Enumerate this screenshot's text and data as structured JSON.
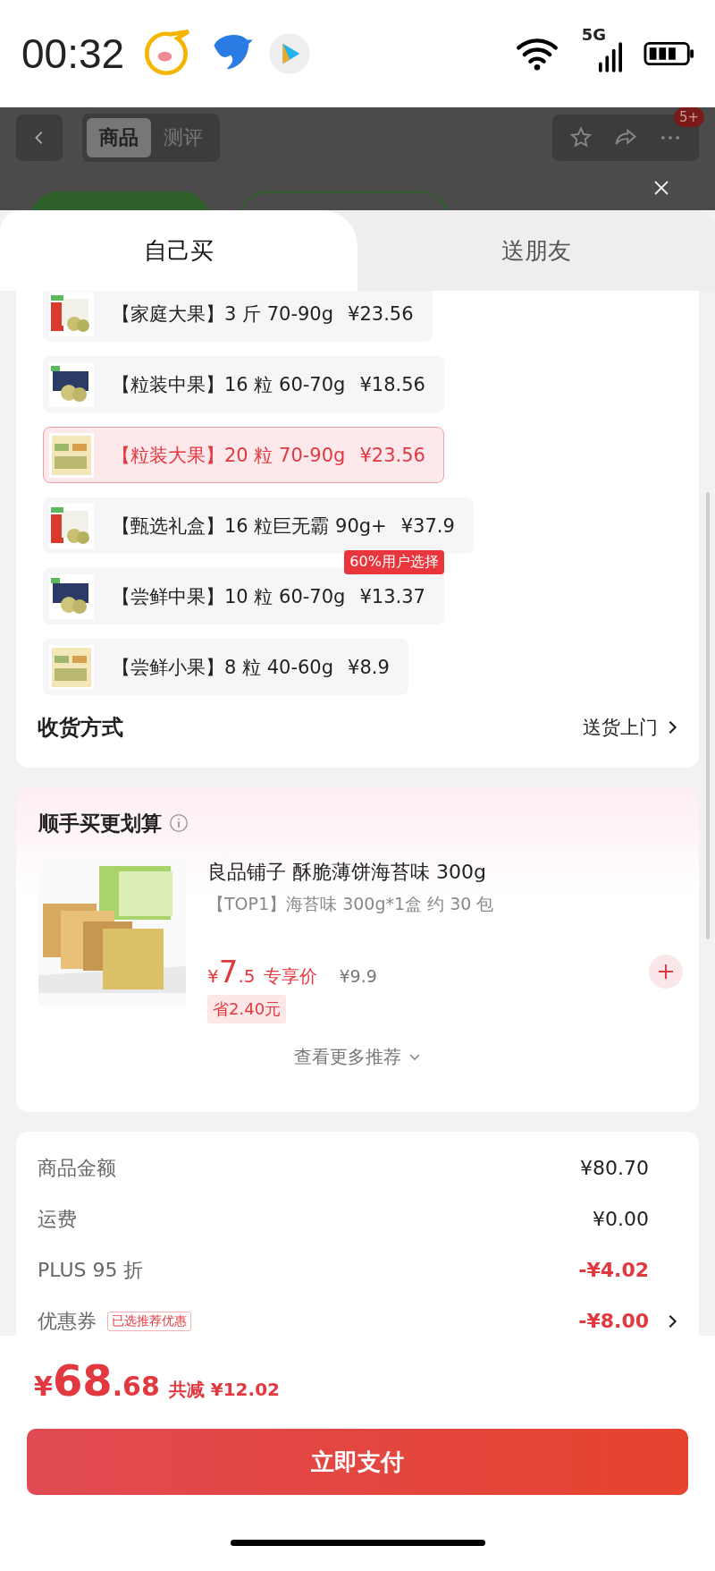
{
  "status_bar": {
    "time": "00:32",
    "network": "5G"
  },
  "nav": {
    "tabs": [
      {
        "label": "商品",
        "selected": true
      },
      {
        "label": "测评",
        "selected": false
      }
    ],
    "badge": "5+"
  },
  "sheet_tabs": [
    {
      "label": "自己买",
      "selected": true
    },
    {
      "label": "送朋友",
      "selected": false
    }
  ],
  "options": [
    {
      "name": "【家庭大果】3 斤 70-90g",
      "price": "¥23.56",
      "selected": false
    },
    {
      "name": "【粒装中果】16 粒 60-70g",
      "price": "¥18.56",
      "selected": false
    },
    {
      "name": "【粒装大果】20 粒 70-90g",
      "price": "¥23.56",
      "selected": true
    },
    {
      "name": "【甄选礼盒】16 粒巨无霸 90g+",
      "price": "¥37.9",
      "selected": false
    },
    {
      "name": "【尝鲜中果】10 粒 60-70g",
      "price": "¥13.37",
      "selected": false,
      "tag": "60%用户选择"
    },
    {
      "name": "【尝鲜小果】8 粒 40-60g",
      "price": "¥8.9",
      "selected": false
    }
  ],
  "delivery": {
    "label": "收货方式",
    "value": "送货上门"
  },
  "addon": {
    "title": "顺手买更划算",
    "product": "良品铺子 酥脆薄饼海苔味 300g",
    "spec": "【TOP1】海苔味 300g*1盒 约 30 包",
    "price_symbol": "¥",
    "price_int": "7",
    "price_dec": ".5",
    "price_label": "专享价",
    "original_price": "¥9.9",
    "saving": "省2.40元",
    "more": "查看更多推荐"
  },
  "summary": [
    {
      "label": "商品金额",
      "value": "¥80.70",
      "kind": "normal",
      "arrow": false
    },
    {
      "label": "运费",
      "value": "¥0.00",
      "kind": "normal",
      "arrow": false
    },
    {
      "label": "PLUS 95 折",
      "value": "-¥4.02",
      "kind": "discount",
      "arrow": false
    },
    {
      "label": "优惠券",
      "tag": "已选推荐优惠",
      "value": "-¥8.00",
      "kind": "discount",
      "arrow": true
    }
  ],
  "total": {
    "symbol": "¥",
    "int": "68",
    "dec": ".68",
    "saved": "共减 ¥12.02"
  },
  "pay_button": "立即支付"
}
